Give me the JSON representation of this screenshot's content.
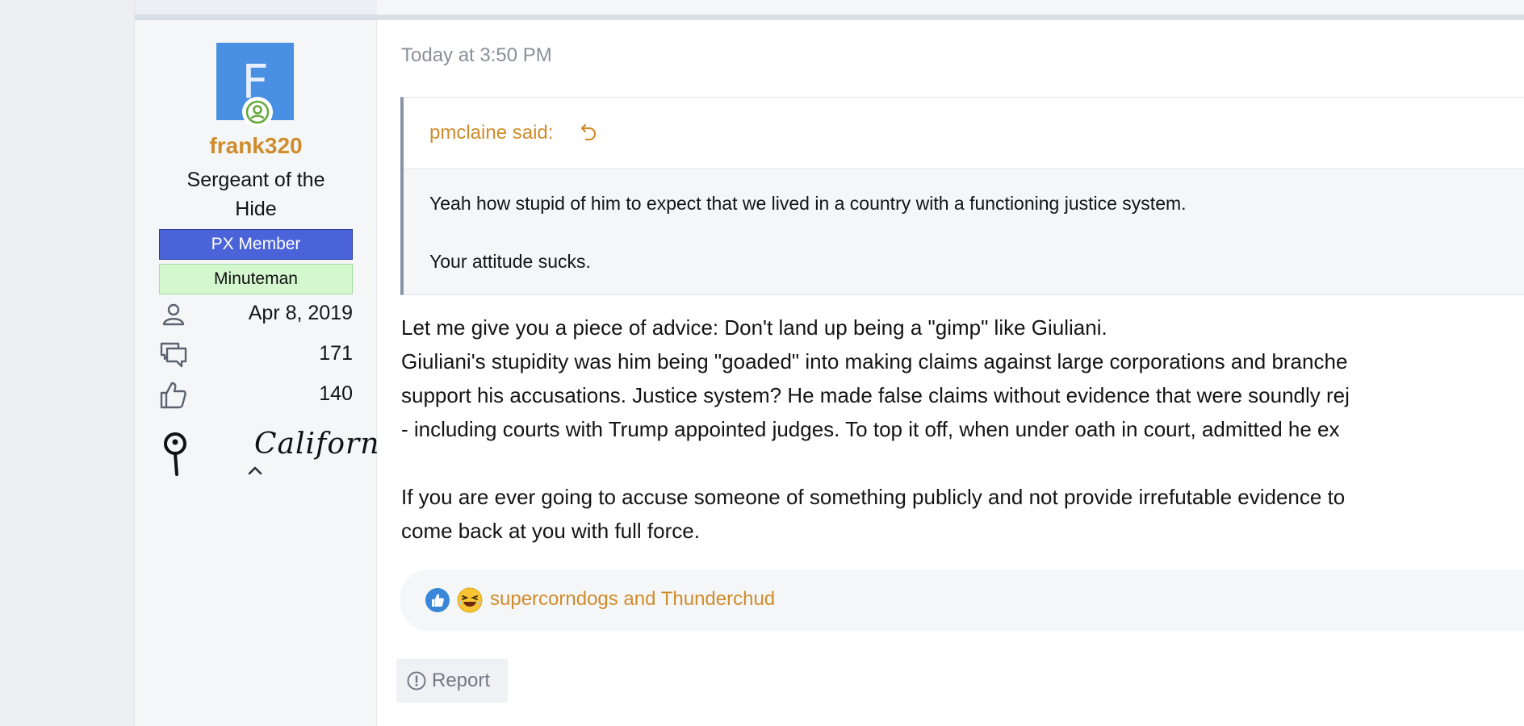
{
  "post": {
    "author": {
      "avatar_letter": "F",
      "username": "frank320",
      "title": "Sergeant of the Hide",
      "banners": [
        "PX Member",
        "Minuteman"
      ],
      "joined": "Apr 8, 2019",
      "messages": "171",
      "reactions": "140",
      "location": "California"
    },
    "date": "Today at 3:50 PM",
    "quote": {
      "author_label": "pmclaine said:",
      "lines": [
        "Yeah how stupid of him to expect that we lived in a country with a functioning justice system.",
        "Your attitude sucks."
      ]
    },
    "message": {
      "paragraph1": [
        "Let me give you a piece of advice: Don't land up being a \"gimp\" like Giuliani.",
        "Giuliani's stupidity was him being \"goaded\" into making claims against large corporations and branche",
        "support his accusations. Justice system? He made false claims without evidence that were soundly rej",
        "- including courts with Trump appointed judges. To top it off, when under oath in court, admitted he ex"
      ],
      "paragraph2": [
        "If you are ever going to accuse someone of something publicly and not provide irrefutable evidence to",
        "come back at you with full force."
      ]
    },
    "reactions": {
      "icons": [
        "like-icon",
        "haha-icon"
      ],
      "users": "supercorndogs and Thunderchud"
    },
    "actions": {
      "report_label": "Report"
    }
  },
  "colors": {
    "link": "#d08c2c",
    "avatar_bg": "#4a90e2",
    "px_banner": "#4b63d8",
    "minuteman_banner": "#d4f7cf",
    "online": "#63a83b"
  }
}
